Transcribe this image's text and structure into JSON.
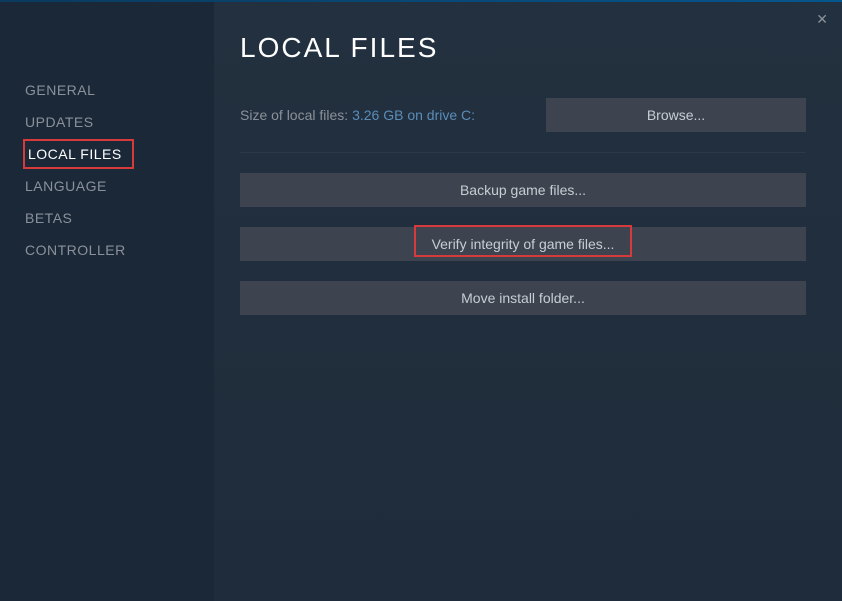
{
  "sidebar": {
    "items": [
      {
        "label": "GENERAL"
      },
      {
        "label": "UPDATES"
      },
      {
        "label": "LOCAL FILES"
      },
      {
        "label": "LANGUAGE"
      },
      {
        "label": "BETAS"
      },
      {
        "label": "CONTROLLER"
      }
    ],
    "selected_index": 2
  },
  "main": {
    "title": "LOCAL FILES",
    "size_label": "Size of local files: ",
    "size_value": "3.26 GB on drive C:",
    "browse_label": "Browse...",
    "backup_label": "Backup game files...",
    "verify_label": "Verify integrity of game files...",
    "move_label": "Move install folder..."
  },
  "close_icon": "✕"
}
